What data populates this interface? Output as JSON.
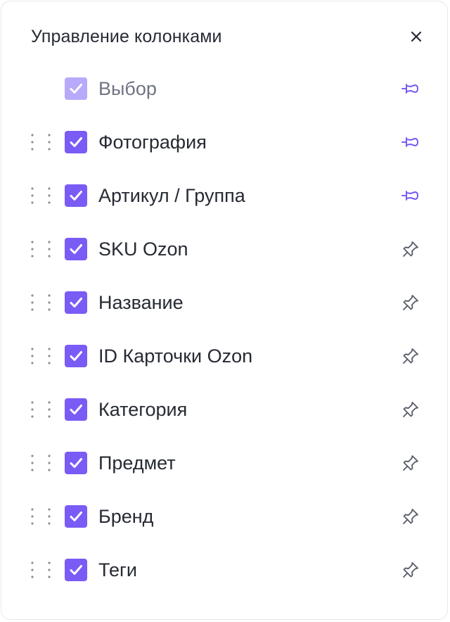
{
  "title": "Управление колонками",
  "colors": {
    "accent": "#7a5bf5",
    "accent_disabled": "#b9a9fb",
    "pinned": "#7a5bf5",
    "unpinned": "#5a5f6b"
  },
  "columns": [
    {
      "label": "Выбор",
      "checked": true,
      "draggable": false,
      "disabled": true,
      "pinned": true
    },
    {
      "label": "Фотография",
      "checked": true,
      "draggable": true,
      "disabled": false,
      "pinned": true
    },
    {
      "label": "Артикул / Группа",
      "checked": true,
      "draggable": true,
      "disabled": false,
      "pinned": true
    },
    {
      "label": "SKU Ozon",
      "checked": true,
      "draggable": true,
      "disabled": false,
      "pinned": false
    },
    {
      "label": "Название",
      "checked": true,
      "draggable": true,
      "disabled": false,
      "pinned": false
    },
    {
      "label": "ID Карточки Ozon",
      "checked": true,
      "draggable": true,
      "disabled": false,
      "pinned": false
    },
    {
      "label": "Категория",
      "checked": true,
      "draggable": true,
      "disabled": false,
      "pinned": false
    },
    {
      "label": "Предмет",
      "checked": true,
      "draggable": true,
      "disabled": false,
      "pinned": false
    },
    {
      "label": "Бренд",
      "checked": true,
      "draggable": true,
      "disabled": false,
      "pinned": false
    },
    {
      "label": "Теги",
      "checked": true,
      "draggable": true,
      "disabled": false,
      "pinned": false
    }
  ]
}
